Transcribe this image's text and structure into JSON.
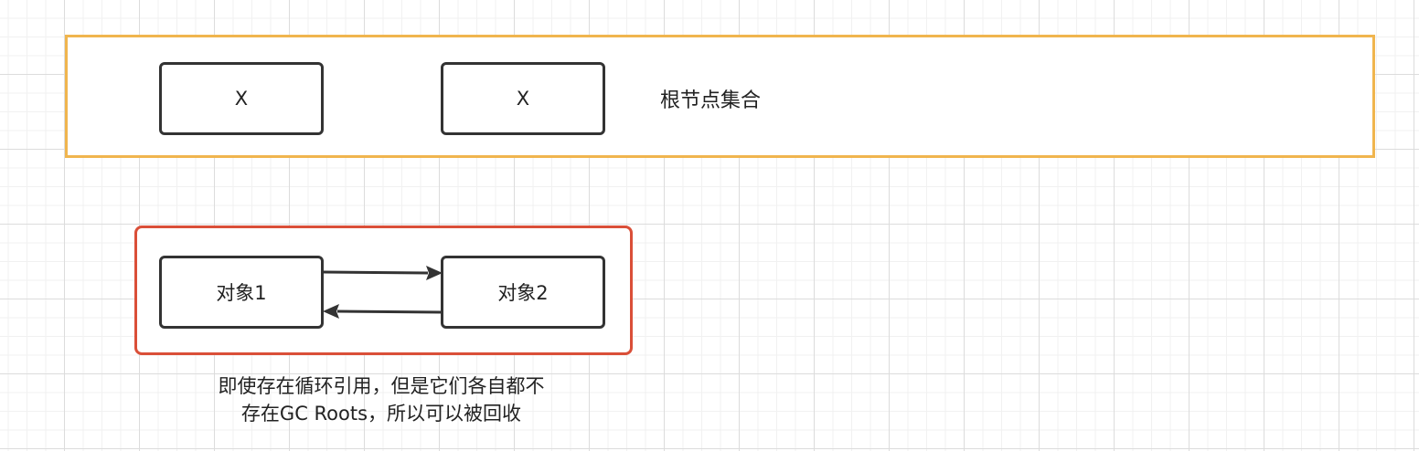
{
  "root_set": {
    "label": "根节点集合",
    "nodes": [
      "X",
      "X"
    ]
  },
  "cycle": {
    "object_1": "对象1",
    "object_2": "对象2"
  },
  "caption": {
    "line1": "即使存在循环引用，但是它们各自都不",
    "line2": "存在GC Roots，所以可以被回收"
  },
  "colors": {
    "root_set_border": "#f0b54e",
    "cycle_border": "#da4f38",
    "node_border": "#333333",
    "arrow": "#333333"
  }
}
